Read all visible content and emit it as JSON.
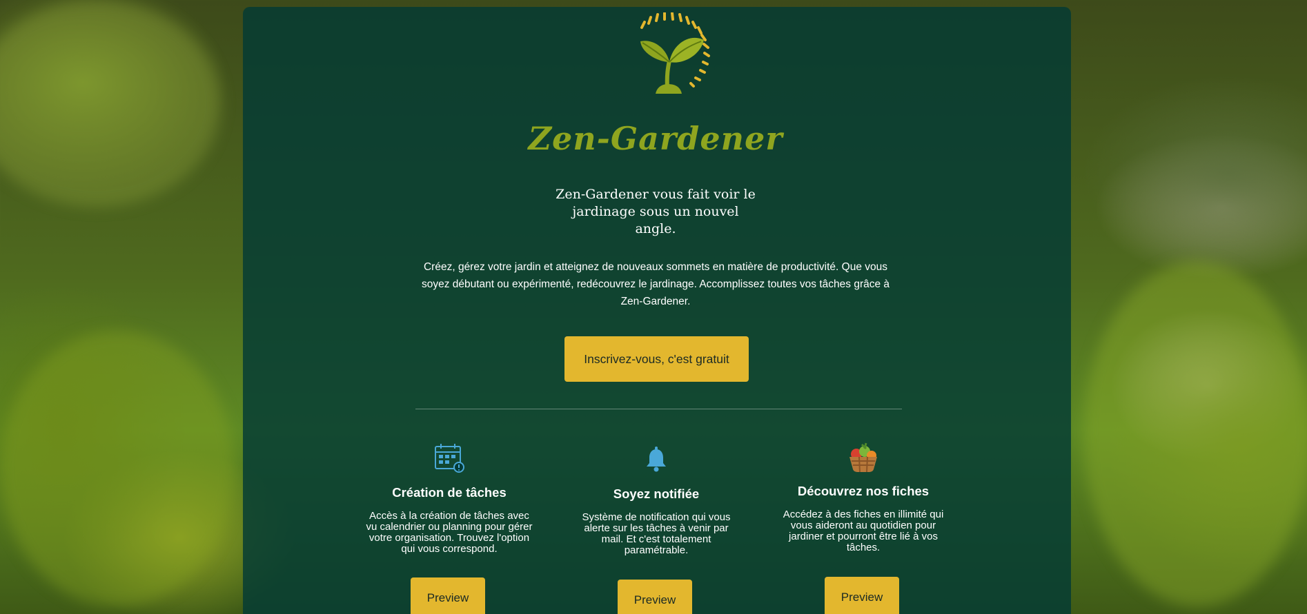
{
  "brand": {
    "name": "Zen-Gardener",
    "tagline": "Zen-Gardener vous fait voir le jardinage sous un nouvel angle."
  },
  "intro": "Créez, gérez votre jardin et atteignez de nouveaux sommets en matière de productivité. Que vous soyez débutant ou expérimenté, redécouvrez le jardinage. Accomplissez toutes vos tâches grâce à Zen-Gardener.",
  "cta_label": "Inscrivez-vous, c'est gratuit",
  "features": [
    {
      "icon": "calendar-icon",
      "title": "Création de tâches",
      "text": "Accès à la création de tâches avec vu calendrier ou planning pour gérer votre organisation. Trouvez l'option qui vous correspond.",
      "button": "Preview"
    },
    {
      "icon": "bell-icon",
      "title": "Soyez notifiée",
      "text": "Système de notification qui vous alerte sur les tâches à venir par mail. Et c'est totalement paramétrable.",
      "button": "Preview"
    },
    {
      "icon": "vegetable-basket-icon",
      "title": "Découvrez nos fiches",
      "text": "Accédez à des fiches en illimité qui vous aideront au quotidien pour jardiner et pourront être lié à vos tâches.",
      "button": "Preview"
    }
  ],
  "colors": {
    "panel": "#033a34",
    "accent": "#e3b72e",
    "brand_green": "#8fa51f",
    "icon_blue": "#4aa8d8"
  }
}
